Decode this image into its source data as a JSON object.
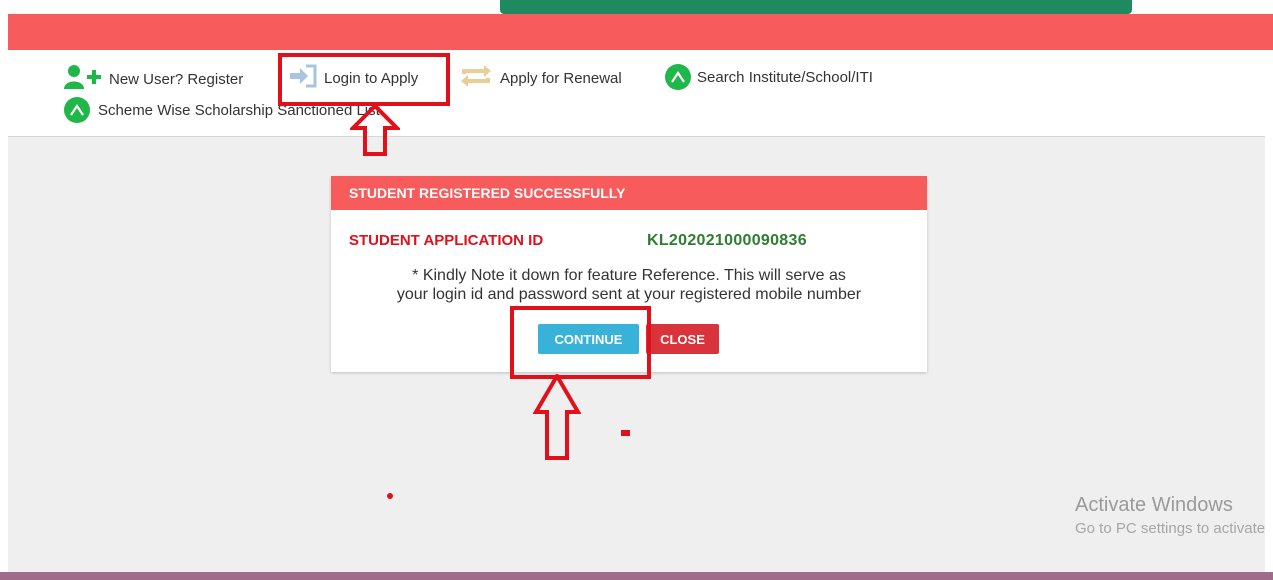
{
  "nav": {
    "items": [
      {
        "label": "New User? Register",
        "icon": "add-user-icon"
      },
      {
        "label": "Login to Apply",
        "icon": "login-arrow-icon"
      },
      {
        "label": "Apply for Renewal",
        "icon": "renewal-icon"
      },
      {
        "label": "Search Institute/School/ITI",
        "icon": "search-circle-icon"
      },
      {
        "label": "Scheme Wise Scholarship Sanctioned List",
        "icon": "list-circle-icon"
      }
    ]
  },
  "modal": {
    "header": "STUDENT REGISTERED SUCCESSFULLY",
    "app_id_label": "STUDENT APPLICATION ID",
    "app_id_value": "KL202021000090836",
    "note_line1": "* Kindly Note it down for feature Reference. This will serve as",
    "note_line2": "your login id and password sent at your registered mobile number",
    "continue_label": "CONTINUE",
    "close_label": "CLOSE"
  },
  "watermark": {
    "title": "Activate Windows",
    "subtitle": "Go to PC settings to activate Windows."
  },
  "colors": {
    "header_red": "#f75b5b",
    "annotation_red": "#e0111b",
    "continue_blue": "#38b2d8",
    "close_red": "#d9343b",
    "id_green": "#2e7d32",
    "icon_green": "#20b74a"
  }
}
